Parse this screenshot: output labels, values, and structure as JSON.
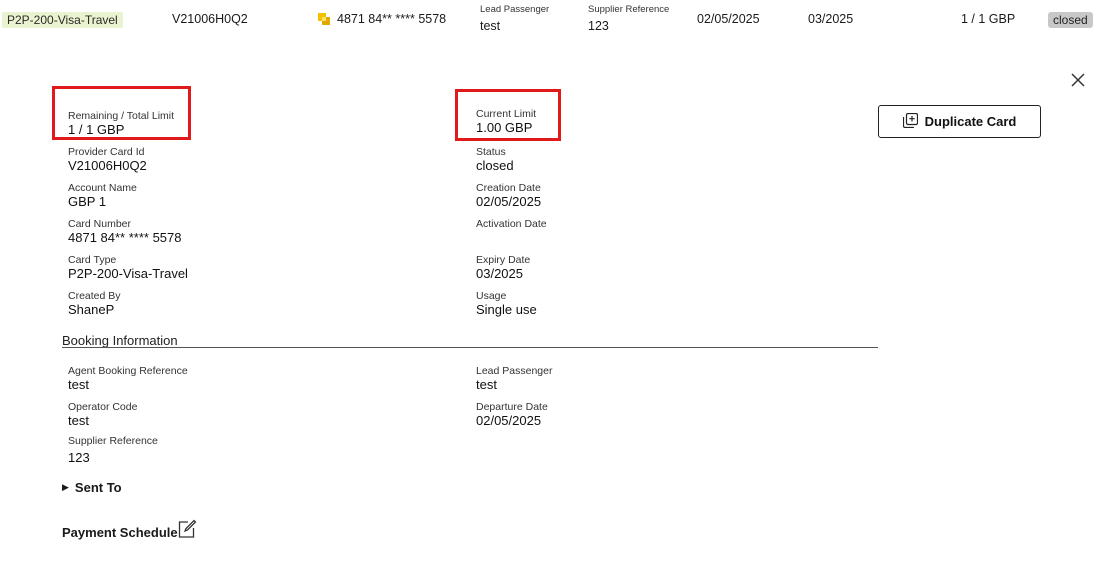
{
  "top_row": {
    "card_type": "P2P-200-Visa-Travel",
    "card_id": "V21006H0Q2",
    "card_number": "4871 84** **** 5578",
    "lead_passenger_label": "Lead Passenger",
    "lead_passenger_value": "test",
    "supplier_ref_label": "Supplier Reference",
    "supplier_ref_value": "123",
    "creation_date": "02/05/2025",
    "expiry": "03/2025",
    "limit": "1 / 1 GBP",
    "status": "closed"
  },
  "detail": {
    "duplicate_label": "Duplicate Card",
    "left": [
      {
        "label": "Remaining / Total Limit",
        "value": "1 / 1 GBP"
      },
      {
        "label": "Provider Card Id",
        "value": "V21006H0Q2"
      },
      {
        "label": "Account Name",
        "value": "GBP 1"
      },
      {
        "label": "Card Number",
        "value": "4871 84** **** 5578"
      },
      {
        "label": "Card Type",
        "value": "P2P-200-Visa-Travel"
      },
      {
        "label": "Created By",
        "value": "ShaneP"
      }
    ],
    "right": [
      {
        "label": "Current Limit",
        "value": "1.00 GBP"
      },
      {
        "label": "Status",
        "value": "closed"
      },
      {
        "label": "Creation Date",
        "value": "02/05/2025"
      },
      {
        "label": "Activation Date",
        "value": ""
      },
      {
        "label": "Expiry Date",
        "value": "03/2025"
      },
      {
        "label": "Usage",
        "value": "Single use"
      }
    ]
  },
  "booking": {
    "title": "Booking Information",
    "left": [
      {
        "label": "Agent Booking Reference",
        "value": "test"
      },
      {
        "label": "Operator Code",
        "value": "test"
      },
      {
        "label": "Supplier Reference",
        "value": "123"
      }
    ],
    "right": [
      {
        "label": "Lead Passenger",
        "value": "test"
      },
      {
        "label": "Departure Date",
        "value": "02/05/2025"
      }
    ]
  },
  "sent_to_label": "Sent To",
  "payment_schedule_label": "Payment Schedule",
  "colors": {
    "highlight": "#e0191b",
    "type_pill": "#eaf3cf",
    "status_pill": "#c8c8c8",
    "card_icon": "#f2c200"
  }
}
